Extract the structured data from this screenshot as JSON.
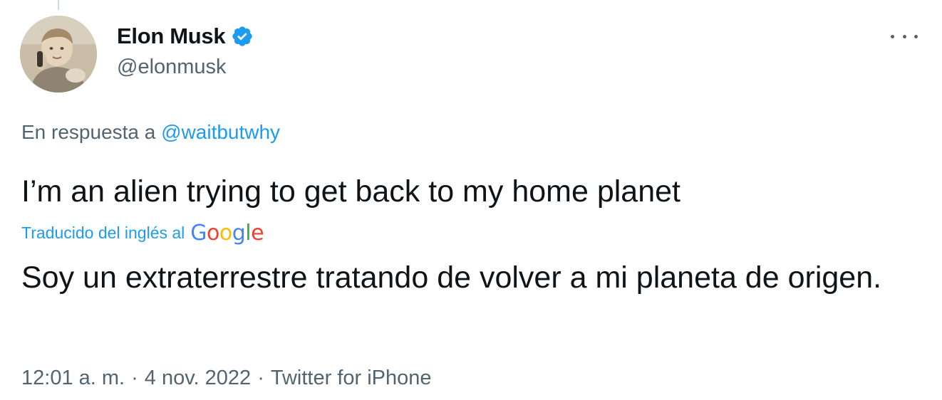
{
  "author": {
    "display_name": "Elon Musk",
    "handle": "@elonmusk",
    "verified": true,
    "avatar_icon": "child-photo-avatar"
  },
  "menu": {
    "more_icon": "ellipsis-icon"
  },
  "reply": {
    "prefix": "En respuesta a",
    "to_handle": "@waitbutwhy"
  },
  "tweet": {
    "text": "I’m an alien trying to get back to my home planet",
    "translation_label": "Traducido del inglés al",
    "translation_provider": "Google",
    "translated_text": "Soy un extraterrestre tratando de volver a mi planeta de origen."
  },
  "meta": {
    "time": "12:01 a. m.",
    "separator": "·",
    "date": "4 nov. 2022",
    "source": "Twitter for iPhone"
  },
  "colors": {
    "accent": "#1d9bf0",
    "text_primary": "#0f1419",
    "text_secondary": "#536471"
  }
}
